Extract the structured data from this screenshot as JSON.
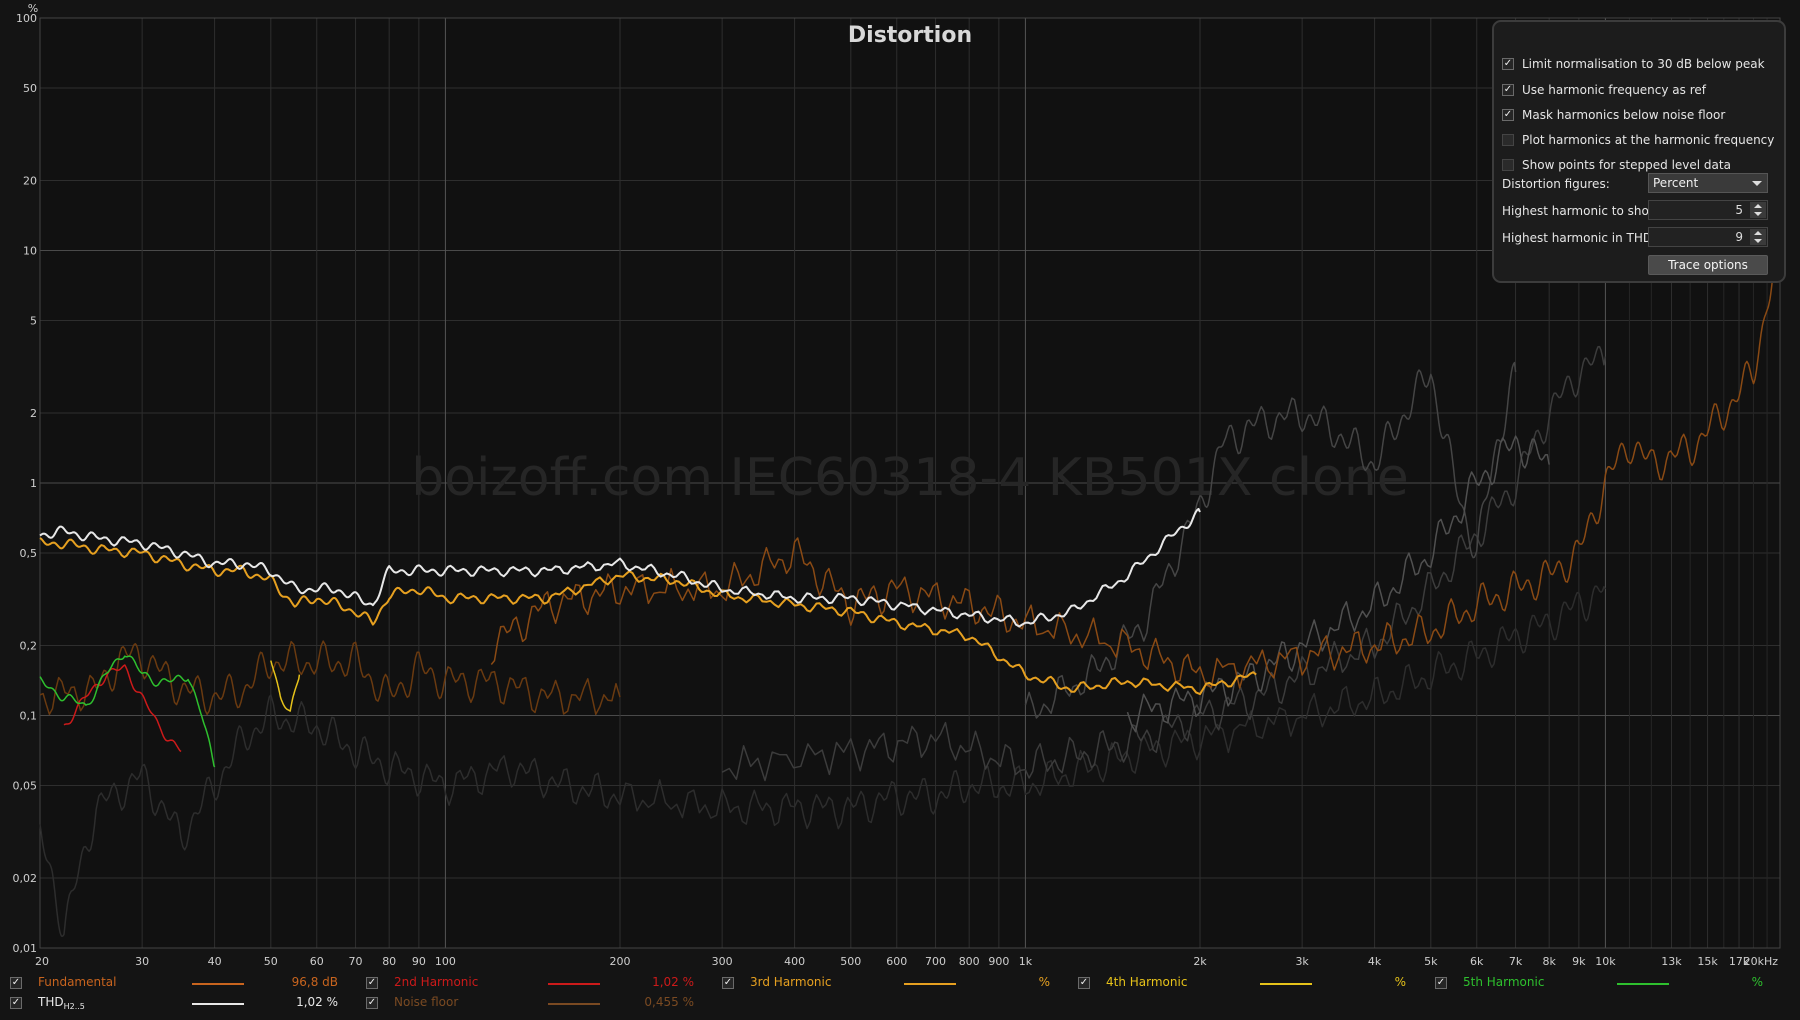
{
  "chart_data": {
    "type": "line",
    "title": "Distortion",
    "watermark": "boizoff.com IEC60318-4 KB501X clone",
    "ylabel": "%",
    "y_scale": "log",
    "x_scale": "log",
    "ylim": [
      0.01,
      100
    ],
    "xlim": [
      20,
      20000
    ],
    "y_ticks": [
      {
        "v": 100,
        "label": "100"
      },
      {
        "v": 50,
        "label": "50"
      },
      {
        "v": 20,
        "label": "20"
      },
      {
        "v": 10,
        "label": "10"
      },
      {
        "v": 5,
        "label": "5"
      },
      {
        "v": 2,
        "label": "2"
      },
      {
        "v": 1,
        "label": "1"
      },
      {
        "v": 0.5,
        "label": "0,5"
      },
      {
        "v": 0.2,
        "label": "0,2"
      },
      {
        "v": 0.1,
        "label": "0,1"
      },
      {
        "v": 0.05,
        "label": "0,05"
      },
      {
        "v": 0.02,
        "label": "0,02"
      },
      {
        "v": 0.01,
        "label": "0,01"
      }
    ],
    "x_ticks": [
      {
        "v": 20,
        "label": "20"
      },
      {
        "v": 30,
        "label": "30"
      },
      {
        "v": 40,
        "label": "40"
      },
      {
        "v": 50,
        "label": "50"
      },
      {
        "v": 60,
        "label": "60"
      },
      {
        "v": 70,
        "label": "70"
      },
      {
        "v": 80,
        "label": "80"
      },
      {
        "v": 90,
        "label": "90"
      },
      {
        "v": 100,
        "label": "100"
      },
      {
        "v": 200,
        "label": "200"
      },
      {
        "v": 300,
        "label": "300"
      },
      {
        "v": 400,
        "label": "400"
      },
      {
        "v": 500,
        "label": "500"
      },
      {
        "v": 600,
        "label": "600"
      },
      {
        "v": 700,
        "label": "700"
      },
      {
        "v": 800,
        "label": "800"
      },
      {
        "v": 900,
        "label": "900"
      },
      {
        "v": 1000,
        "label": "1k"
      },
      {
        "v": 2000,
        "label": "2k"
      },
      {
        "v": 3000,
        "label": "3k"
      },
      {
        "v": 4000,
        "label": "4k"
      },
      {
        "v": 5000,
        "label": "5k"
      },
      {
        "v": 6000,
        "label": "6k"
      },
      {
        "v": 7000,
        "label": "7k"
      },
      {
        "v": 8000,
        "label": "8k"
      },
      {
        "v": 9000,
        "label": "9k"
      },
      {
        "v": 10000,
        "label": "10k"
      },
      {
        "v": 13000,
        "label": "13k"
      },
      {
        "v": 15000,
        "label": "15k"
      },
      {
        "v": 17000,
        "label": "17k"
      },
      {
        "v": 20000,
        "label": "20kHz"
      }
    ],
    "grid": true,
    "series": [
      {
        "name": "Noise floor",
        "color": "#2d2d2d",
        "x": [
          20,
          21,
          22,
          25,
          30,
          35,
          40,
          45,
          50,
          60,
          70,
          80,
          100,
          130,
          160,
          200,
          300,
          400,
          500,
          600,
          700,
          800,
          1000,
          1300,
          1600,
          2000,
          3000,
          4000,
          5000,
          6000,
          7000,
          8000,
          9000,
          10000
        ],
        "y": [
          0.03,
          0.02,
          0.012,
          0.04,
          0.055,
          0.03,
          0.05,
          0.08,
          0.1,
          0.09,
          0.07,
          0.06,
          0.05,
          0.06,
          0.05,
          0.045,
          0.04,
          0.04,
          0.04,
          0.045,
          0.045,
          0.05,
          0.05,
          0.06,
          0.07,
          0.08,
          0.1,
          0.12,
          0.15,
          0.18,
          0.22,
          0.25,
          0.3,
          0.35
        ]
      },
      {
        "name": "5th Harmonic trace (grey)",
        "color": "#3c3c3c",
        "x": [
          300,
          500,
          700,
          1000,
          1300,
          1600,
          2000,
          2500,
          3000,
          4000,
          5000,
          6000,
          7000,
          8000,
          9000,
          10000
        ],
        "y": [
          0.06,
          0.07,
          0.08,
          0.06,
          0.07,
          0.08,
          0.1,
          0.12,
          0.15,
          0.2,
          0.35,
          0.6,
          1.0,
          2.0,
          3.0,
          3.5
        ]
      },
      {
        "name": "4th Harmonic trace (grey)",
        "color": "#454545",
        "x": [
          1000,
          1300,
          1600,
          2000,
          2200,
          2500,
          3000,
          3500,
          4000,
          4500,
          5000,
          5500,
          6000,
          6500,
          7000
        ],
        "y": [
          0.1,
          0.15,
          0.25,
          0.8,
          1.5,
          1.8,
          2.0,
          1.6,
          1.2,
          2.0,
          3.0,
          1.0,
          0.5,
          1.5,
          3.0
        ]
      },
      {
        "name": "3rd Harmonic trace (grey)",
        "color": "#505050",
        "x": [
          1500,
          2000,
          2500,
          3000,
          4000,
          5000,
          6000,
          7000,
          8000
        ],
        "y": [
          0.1,
          0.12,
          0.15,
          0.2,
          0.3,
          0.5,
          1.0,
          1.5,
          1.2
        ]
      },
      {
        "name": "Noise floor (orange)",
        "color": "#6a3a10",
        "x": [
          20,
          25,
          28,
          30,
          35,
          40,
          45,
          50,
          60,
          70,
          80,
          90,
          100,
          120,
          150,
          200
        ],
        "y": [
          0.12,
          0.13,
          0.18,
          0.18,
          0.13,
          0.12,
          0.13,
          0.17,
          0.17,
          0.17,
          0.12,
          0.16,
          0.14,
          0.14,
          0.12,
          0.12
        ]
      },
      {
        "name": "2nd Harmonic",
        "color": "#cc1a1a",
        "x": [
          22,
          24,
          26,
          28,
          30,
          32,
          35
        ],
        "y": [
          0.09,
          0.12,
          0.15,
          0.16,
          0.12,
          0.09,
          0.07
        ]
      },
      {
        "name": "5th Harmonic",
        "color": "#2ec02e",
        "x": [
          20,
          22,
          24,
          26,
          28,
          30,
          32,
          34,
          36,
          38,
          40
        ],
        "y": [
          0.14,
          0.12,
          0.11,
          0.15,
          0.19,
          0.15,
          0.14,
          0.14,
          0.15,
          0.1,
          0.06
        ]
      },
      {
        "name": "4th Harmonic",
        "color": "#e6c21a",
        "x": [
          50,
          52,
          54,
          56
        ],
        "y": [
          0.18,
          0.12,
          0.1,
          0.15
        ]
      },
      {
        "name": "Fundamental-range harmonic (orange noisy)",
        "color": "#8a4a14",
        "x": [
          120,
          150,
          200,
          300,
          400,
          500,
          600,
          800,
          1000,
          1500,
          2000,
          3000,
          4000,
          5000,
          6000,
          7000,
          8000,
          9000,
          10000,
          11000,
          12000,
          14000,
          16000,
          18000,
          19000,
          20000
        ],
        "y": [
          0.2,
          0.3,
          0.35,
          0.35,
          0.5,
          0.3,
          0.35,
          0.3,
          0.25,
          0.2,
          0.15,
          0.18,
          0.2,
          0.23,
          0.3,
          0.35,
          0.4,
          0.5,
          1.0,
          1.5,
          1.2,
          1.4,
          2.0,
          3.0,
          6.0,
          10.0
        ]
      },
      {
        "name": "3rd Harmonic",
        "color": "#e6a020",
        "x": [
          20,
          22,
          25,
          30,
          35,
          40,
          45,
          50,
          55,
          60,
          65,
          70,
          75,
          80,
          90,
          100,
          120,
          150,
          200,
          250,
          300,
          400,
          500,
          600,
          800,
          1000,
          1200,
          1500,
          2000,
          2500
        ],
        "y": [
          0.55,
          0.55,
          0.52,
          0.5,
          0.45,
          0.42,
          0.42,
          0.38,
          0.3,
          0.32,
          0.3,
          0.28,
          0.25,
          0.33,
          0.35,
          0.32,
          0.32,
          0.32,
          0.4,
          0.38,
          0.33,
          0.3,
          0.28,
          0.25,
          0.22,
          0.15,
          0.13,
          0.14,
          0.13,
          0.15
        ]
      },
      {
        "name": "THD",
        "color": "#e8e8e8",
        "x": [
          20,
          22,
          25,
          30,
          35,
          40,
          45,
          50,
          55,
          60,
          65,
          70,
          75,
          80,
          90,
          100,
          120,
          150,
          200,
          250,
          300,
          400,
          500,
          600,
          800,
          1000,
          1200,
          1500,
          1800,
          2000
        ],
        "y": [
          0.6,
          0.62,
          0.58,
          0.55,
          0.5,
          0.45,
          0.45,
          0.42,
          0.35,
          0.35,
          0.35,
          0.32,
          0.3,
          0.42,
          0.42,
          0.42,
          0.42,
          0.42,
          0.45,
          0.4,
          0.35,
          0.32,
          0.32,
          0.3,
          0.27,
          0.25,
          0.28,
          0.4,
          0.6,
          0.75
        ]
      }
    ]
  },
  "options_panel": {
    "checkboxes": [
      {
        "label": "Limit normalisation to 30 dB below peak",
        "checked": true
      },
      {
        "label": "Use harmonic frequency as ref",
        "checked": true
      },
      {
        "label": "Mask harmonics below noise floor",
        "checked": true
      },
      {
        "label": "Plot harmonics at the harmonic frequency",
        "checked": false
      },
      {
        "label": "Show points for stepped level data",
        "checked": false
      }
    ],
    "distortion_figures_label": "Distortion figures:",
    "distortion_figures_value": "Percent",
    "highest_harmonic_show_label": "Highest harmonic to show:",
    "highest_harmonic_show_value": "5",
    "highest_harmonic_thd_label": "Highest harmonic in THD:",
    "highest_harmonic_thd_value": "9",
    "trace_options_label": "Trace options"
  },
  "legend": [
    {
      "name": "Fundamental",
      "color": "#c8641e",
      "value": "96,8 dB",
      "checked": true
    },
    {
      "name": "2nd Harmonic",
      "color": "#cc1a1a",
      "value": "1,02 %",
      "checked": true
    },
    {
      "name": "3rd Harmonic",
      "color": "#e6a020",
      "value": "%",
      "checked": true
    },
    {
      "name": "4th Harmonic",
      "color": "#e6c21a",
      "value": "%",
      "checked": true
    },
    {
      "name": "5th Harmonic",
      "color": "#2ec02e",
      "value": "%",
      "checked": true
    },
    {
      "name": "THD",
      "name_sub": "H2..5",
      "color": "#e8e8e8",
      "value": "1,02 %",
      "checked": true
    },
    {
      "name": "Noise floor",
      "color": "#7a4a22",
      "value": "0,455 %",
      "checked": true
    }
  ]
}
